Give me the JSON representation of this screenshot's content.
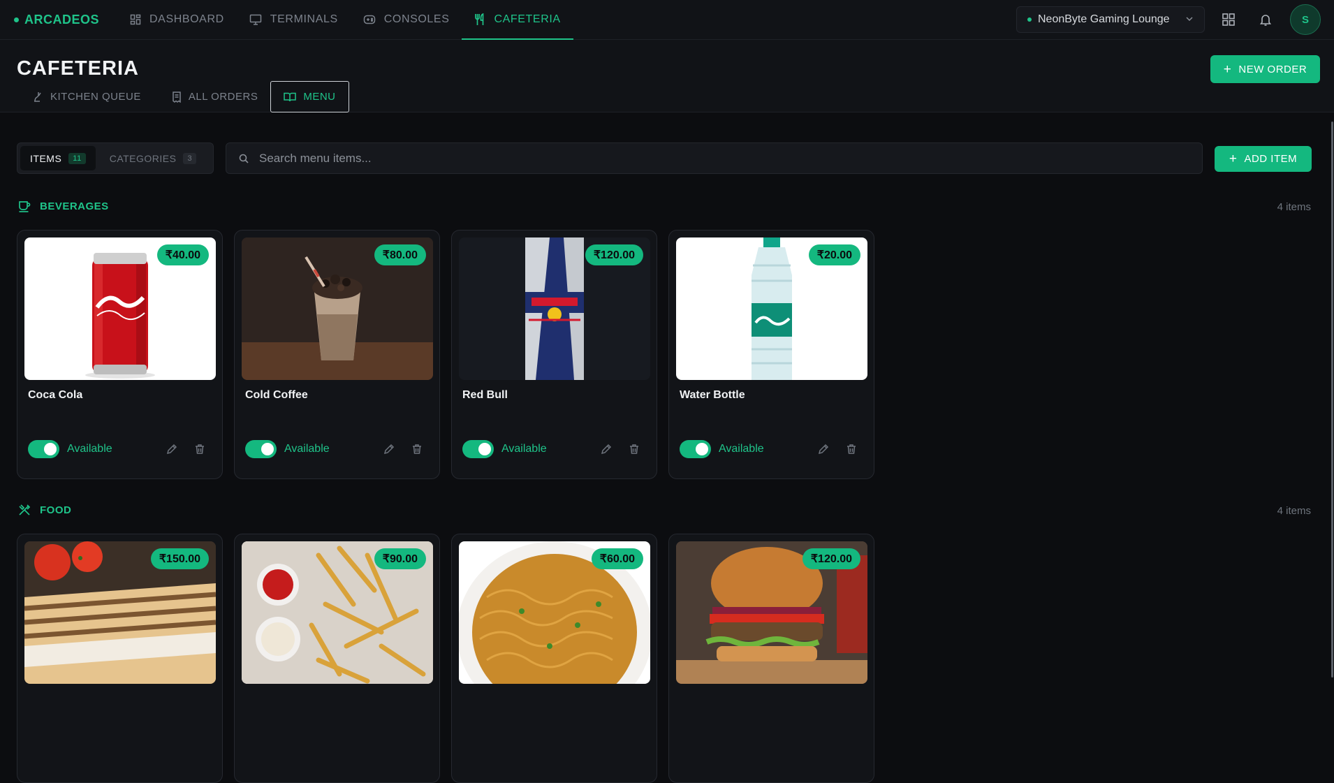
{
  "brand": {
    "name": "ARCADEOS"
  },
  "nav": {
    "tabs": [
      {
        "label": "DASHBOARD",
        "icon": "dashboard-icon"
      },
      {
        "label": "TERMINALS",
        "icon": "monitor-icon"
      },
      {
        "label": "CONSOLES",
        "icon": "gamepad-icon"
      },
      {
        "label": "CAFETERIA",
        "icon": "utensils-icon",
        "active": true
      }
    ],
    "lounge": "NeonByte Gaming Lounge",
    "avatar_initial": "S"
  },
  "header": {
    "title": "CAFETERIA",
    "new_order_label": "NEW ORDER",
    "subtabs": [
      {
        "label": "KITCHEN QUEUE",
        "icon": "chef-icon"
      },
      {
        "label": "ALL ORDERS",
        "icon": "receipt-icon"
      },
      {
        "label": "MENU",
        "icon": "book-open-icon",
        "active": true
      }
    ]
  },
  "toolbar": {
    "items_label": "ITEMS",
    "items_count": "11",
    "categories_label": "CATEGORIES",
    "categories_count": "3",
    "search_placeholder": "Search menu items...",
    "search_value": "",
    "add_item_label": "ADD ITEM"
  },
  "sections": [
    {
      "name": "BEVERAGES",
      "icon": "cup-icon",
      "count_label": "4 items",
      "items": [
        {
          "name": "Coca Cola",
          "price": "₹40.00",
          "status": "Available",
          "image": "coca-cola-can-image"
        },
        {
          "name": "Cold Coffee",
          "price": "₹80.00",
          "status": "Available",
          "image": "cold-coffee-image"
        },
        {
          "name": "Red Bull",
          "price": "₹120.00",
          "status": "Available",
          "image": "red-bull-can-image"
        },
        {
          "name": "Water Bottle",
          "price": "₹20.00",
          "status": "Available",
          "image": "water-bottle-image"
        }
      ]
    },
    {
      "name": "FOOD",
      "icon": "fork-knife-icon",
      "count_label": "4 items",
      "items": [
        {
          "price": "₹150.00",
          "image": "sandwich-image"
        },
        {
          "price": "₹90.00",
          "image": "french-fries-image"
        },
        {
          "price": "₹60.00",
          "image": "noodles-image"
        },
        {
          "price": "₹120.00",
          "image": "burger-image"
        }
      ]
    }
  ],
  "colors": {
    "accent": "#14b87f",
    "background": "#0c0d10",
    "panel": "#111317"
  }
}
